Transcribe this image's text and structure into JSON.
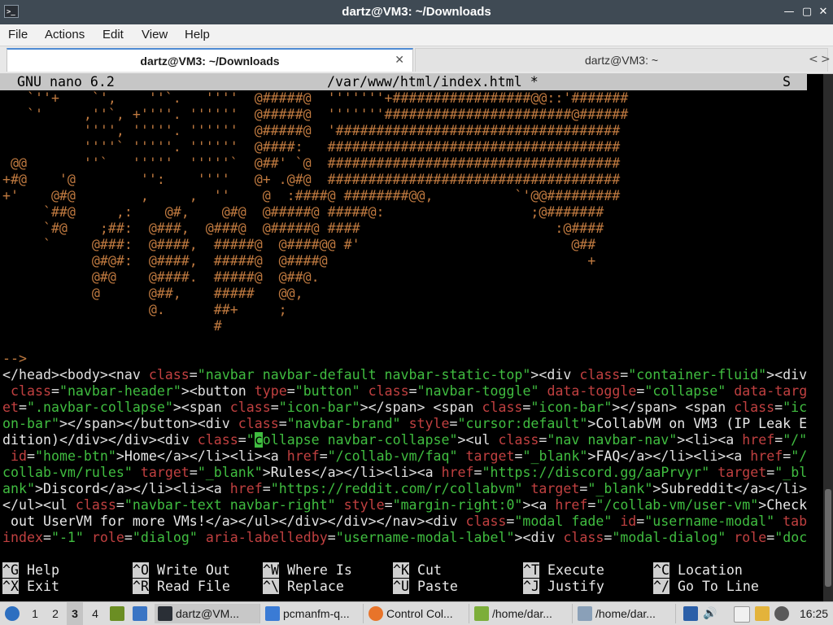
{
  "window": {
    "title": "dartz@VM3: ~/Downloads",
    "controls": [
      "—",
      "▢",
      "✕"
    ]
  },
  "menu": [
    "File",
    "Actions",
    "Edit",
    "View",
    "Help"
  ],
  "tabs": [
    {
      "label": "dartz@VM3: ~/Downloads",
      "close": "✕"
    },
    {
      "label": "dartz@VM3: ~"
    }
  ],
  "tab_scroll": {
    "left": "<",
    "right": ">"
  },
  "nano": {
    "version": "GNU nano 6.2",
    "file": "/var/www/html/index.html *",
    "status": "S"
  },
  "art_lines": [
    "   `''+    `',    ''`.   ''''  @#####@  '''''''+#################@@::'#######",
    "   `'     ,''`, +''''. ''''''  @#####@  '''''''#######################@######",
    "          '''', '''''. ''''''  @#####@  '###################################",
    "          ''''` '''''. ''''''  @####:   ####################################",
    " @@       ''`   '''''  '''''`  @##' `@  ####################################",
    "+#@    '@        '':    ''''   @+ .@#@  ####################################",
    "+'    @#@        ,     ,  ''    @  :####@ ########@@,          `'@@#########",
    "     `##@     ,:    @#,    @#@  @#####@ #####@:                  ;@#######",
    "     `#@    ;##:  @###,  @###@  @#####@ ####                        :@####",
    "     `     @###:  @####,  #####@  @####@@ #'                          @##",
    "           @#@#:  @####,  #####@  @####@                                +",
    "           @#@    @####.  #####@  @##@.",
    "           @      @##,    #####   @@,",
    "                  @.      ##+     ;",
    "                          #",
    "",
    "-->"
  ],
  "html_lines": [
    [
      [
        "tag",
        "</head><body><nav "
      ],
      [
        "attr",
        "class"
      ],
      [
        "tag",
        "="
      ],
      [
        "val",
        "\"navbar navbar-default navbar-static-top\""
      ],
      [
        "tag",
        "><div "
      ],
      [
        "attr",
        "class"
      ],
      [
        "tag",
        "="
      ],
      [
        "val",
        "\"container-fluid\""
      ],
      [
        "tag",
        "><div"
      ]
    ],
    [
      [
        "attr",
        " class"
      ],
      [
        "tag",
        "="
      ],
      [
        "val",
        "\"navbar-header\""
      ],
      [
        "tag",
        "><button "
      ],
      [
        "attr",
        "type"
      ],
      [
        "tag",
        "="
      ],
      [
        "val",
        "\"button\""
      ],
      [
        "tag",
        " "
      ],
      [
        "attr",
        "class"
      ],
      [
        "tag",
        "="
      ],
      [
        "val",
        "\"navbar-toggle\""
      ],
      [
        "tag",
        " "
      ],
      [
        "attr",
        "data-toggle"
      ],
      [
        "tag",
        "="
      ],
      [
        "val",
        "\"collapse\""
      ],
      [
        "tag",
        " "
      ],
      [
        "attr",
        "data-targ"
      ]
    ],
    [
      [
        "attr",
        "et"
      ],
      [
        "tag",
        "="
      ],
      [
        "val",
        "\".navbar-collapse\""
      ],
      [
        "tag",
        "><span "
      ],
      [
        "attr",
        "class"
      ],
      [
        "tag",
        "="
      ],
      [
        "val",
        "\"icon-bar\""
      ],
      [
        "tag",
        "></span> <span "
      ],
      [
        "attr",
        "class"
      ],
      [
        "tag",
        "="
      ],
      [
        "val",
        "\"icon-bar\""
      ],
      [
        "tag",
        "></span> <span "
      ],
      [
        "attr",
        "class"
      ],
      [
        "tag",
        "="
      ],
      [
        "val",
        "\"ic"
      ]
    ],
    [
      [
        "val",
        "on-bar\""
      ],
      [
        "tag",
        "></span></button><div "
      ],
      [
        "attr",
        "class"
      ],
      [
        "tag",
        "="
      ],
      [
        "val",
        "\"navbar-brand\""
      ],
      [
        "tag",
        " "
      ],
      [
        "attr",
        "style"
      ],
      [
        "tag",
        "="
      ],
      [
        "val",
        "\"cursor:default\""
      ],
      [
        "tag",
        ">"
      ],
      [
        "txt",
        "CollabVM on VM3 (IP Leak E"
      ]
    ],
    [
      [
        "txt",
        "dition)"
      ],
      [
        "tag",
        "</div></div><div "
      ],
      [
        "attr",
        "class"
      ],
      [
        "tag",
        "="
      ],
      [
        "val",
        "\""
      ],
      [
        "cursor",
        "c"
      ],
      [
        "val",
        "ollapse navbar-collapse\""
      ],
      [
        "tag",
        "><ul "
      ],
      [
        "attr",
        "class"
      ],
      [
        "tag",
        "="
      ],
      [
        "val",
        "\"nav navbar-nav\""
      ],
      [
        "tag",
        "><li><a "
      ],
      [
        "attr",
        "href"
      ],
      [
        "tag",
        "="
      ],
      [
        "val",
        "\"/\""
      ]
    ],
    [
      [
        "attr",
        " id"
      ],
      [
        "tag",
        "="
      ],
      [
        "val",
        "\"home-btn\""
      ],
      [
        "tag",
        ">"
      ],
      [
        "txt",
        "Home"
      ],
      [
        "tag",
        "</a></li><li><a "
      ],
      [
        "attr",
        "href"
      ],
      [
        "tag",
        "="
      ],
      [
        "val",
        "\"/collab-vm/faq\""
      ],
      [
        "tag",
        " "
      ],
      [
        "attr",
        "target"
      ],
      [
        "tag",
        "="
      ],
      [
        "val",
        "\"_blank\""
      ],
      [
        "tag",
        ">"
      ],
      [
        "txt",
        "FAQ"
      ],
      [
        "tag",
        "</a></li><li><a "
      ],
      [
        "attr",
        "href"
      ],
      [
        "tag",
        "="
      ],
      [
        "val",
        "\"/"
      ]
    ],
    [
      [
        "val",
        "collab-vm/rules\""
      ],
      [
        "tag",
        " "
      ],
      [
        "attr",
        "target"
      ],
      [
        "tag",
        "="
      ],
      [
        "val",
        "\"_blank\""
      ],
      [
        "tag",
        ">"
      ],
      [
        "txt",
        "Rules"
      ],
      [
        "tag",
        "</a></li><li><a "
      ],
      [
        "attr",
        "href"
      ],
      [
        "tag",
        "="
      ],
      [
        "val",
        "\"https://discord.gg/aaPrvyr\""
      ],
      [
        "tag",
        " "
      ],
      [
        "attr",
        "target"
      ],
      [
        "tag",
        "="
      ],
      [
        "val",
        "\"_bl"
      ]
    ],
    [
      [
        "val",
        "ank\""
      ],
      [
        "tag",
        ">"
      ],
      [
        "txt",
        "Discord"
      ],
      [
        "tag",
        "</a></li><li><a "
      ],
      [
        "attr",
        "href"
      ],
      [
        "tag",
        "="
      ],
      [
        "val",
        "\"https://reddit.com/r/collabvm\""
      ],
      [
        "tag",
        " "
      ],
      [
        "attr",
        "target"
      ],
      [
        "tag",
        "="
      ],
      [
        "val",
        "\"_blank\""
      ],
      [
        "tag",
        ">"
      ],
      [
        "txt",
        "Subreddit"
      ],
      [
        "tag",
        "</a></li>"
      ]
    ],
    [
      [
        "tag",
        "</ul><ul "
      ],
      [
        "attr",
        "class"
      ],
      [
        "tag",
        "="
      ],
      [
        "val",
        "\"navbar-text navbar-right\""
      ],
      [
        "tag",
        " "
      ],
      [
        "attr",
        "style"
      ],
      [
        "tag",
        "="
      ],
      [
        "val",
        "\"margin-right:0\""
      ],
      [
        "tag",
        "><a "
      ],
      [
        "attr",
        "href"
      ],
      [
        "tag",
        "="
      ],
      [
        "val",
        "\"/collab-vm/user-vm\""
      ],
      [
        "tag",
        ">"
      ],
      [
        "txt",
        "Check"
      ]
    ],
    [
      [
        "txt",
        " out UserVM for more VMs!"
      ],
      [
        "tag",
        "</a></ul></div></div></nav><div "
      ],
      [
        "attr",
        "class"
      ],
      [
        "tag",
        "="
      ],
      [
        "val",
        "\"modal fade\""
      ],
      [
        "tag",
        " "
      ],
      [
        "attr",
        "id"
      ],
      [
        "tag",
        "="
      ],
      [
        "val",
        "\"username-modal\""
      ],
      [
        "tag",
        " "
      ],
      [
        "attr",
        "tab"
      ]
    ],
    [
      [
        "attr",
        "index"
      ],
      [
        "tag",
        "="
      ],
      [
        "val",
        "\"-1\""
      ],
      [
        "tag",
        " "
      ],
      [
        "attr",
        "role"
      ],
      [
        "tag",
        "="
      ],
      [
        "val",
        "\"dialog\""
      ],
      [
        "tag",
        " "
      ],
      [
        "attr",
        "aria-labelledby"
      ],
      [
        "tag",
        "="
      ],
      [
        "val",
        "\"username-modal-label\""
      ],
      [
        "tag",
        "><div "
      ],
      [
        "attr",
        "class"
      ],
      [
        "tag",
        "="
      ],
      [
        "val",
        "\"modal-dialog\""
      ],
      [
        "tag",
        " "
      ],
      [
        "attr",
        "role"
      ],
      [
        "tag",
        "="
      ],
      [
        "val",
        "\"doc"
      ]
    ]
  ],
  "shortcuts_row1": [
    {
      "key": "^G",
      "label": "Help"
    },
    {
      "key": "^O",
      "label": "Write Out"
    },
    {
      "key": "^W",
      "label": "Where Is"
    },
    {
      "key": "^K",
      "label": "Cut"
    },
    {
      "key": "^T",
      "label": "Execute"
    },
    {
      "key": "^C",
      "label": "Location"
    }
  ],
  "shortcuts_row2": [
    {
      "key": "^X",
      "label": "Exit"
    },
    {
      "key": "^R",
      "label": "Read File"
    },
    {
      "key": "^\\",
      "label": "Replace"
    },
    {
      "key": "^U",
      "label": "Paste"
    },
    {
      "key": "^J",
      "label": "Justify"
    },
    {
      "key": "^/",
      "label": "Go To Line"
    }
  ],
  "taskbar": {
    "workspaces": [
      "1",
      "2",
      "3",
      "4"
    ],
    "active_workspace": "3",
    "tasks": [
      {
        "label": "dartz@VM...",
        "icon": "terminal-icon"
      },
      {
        "label": "pcmanfm-q...",
        "icon": "folder-icon"
      },
      {
        "label": "Control Col...",
        "icon": "firefox-icon"
      },
      {
        "label": "/home/dar...",
        "icon": "text-editor-icon"
      },
      {
        "label": "/home/dar...",
        "icon": "image-viewer-icon"
      }
    ],
    "clock": "16:25"
  }
}
